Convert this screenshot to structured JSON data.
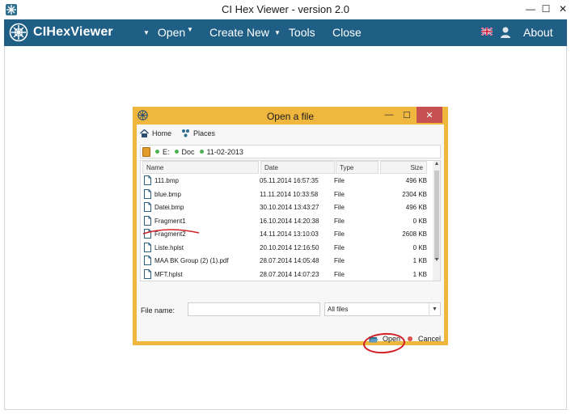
{
  "window": {
    "title": "CI Hex Viewer - version 2.0",
    "controls": {
      "minimize": "—",
      "maximize": "☐",
      "close": "✕"
    }
  },
  "navbar": {
    "brand": "CIHexViewer",
    "menu": [
      {
        "label": "Open",
        "has_caret": true
      },
      {
        "label": "Create New",
        "has_caret": true
      },
      {
        "label": "Tools",
        "has_caret": true
      },
      {
        "label": "Close",
        "has_caret": false
      }
    ],
    "about": "About",
    "language_icon": "uk-flag-icon",
    "user_icon": "user-icon"
  },
  "dialog": {
    "title": "Open a file",
    "toolbar": {
      "home": "Home",
      "places": "Places"
    },
    "path": [
      "E:",
      "Doc",
      "11-02-2013"
    ],
    "columns": {
      "name": "Name",
      "date": "Date",
      "type": "Type",
      "size": "Size"
    },
    "files": [
      {
        "name": "111.bmp",
        "date": "05.11.2014 16:57:35",
        "type": "File",
        "size": "496 KB"
      },
      {
        "name": "blue.bmp",
        "date": "11.11.2014 10:33:58",
        "type": "File",
        "size": "2304 KB"
      },
      {
        "name": "Datei.bmp",
        "date": "30.10.2014 13:43:27",
        "type": "File",
        "size": "496 KB"
      },
      {
        "name": "Fragment1",
        "date": "16.10.2014 14:20:38",
        "type": "File",
        "size": "0 KB"
      },
      {
        "name": "Fragment2",
        "date": "14.11.2014 13:10:03",
        "type": "File",
        "size": "2608 KB"
      },
      {
        "name": "Liste.hplst",
        "date": "20.10.2014 12:16:50",
        "type": "File",
        "size": "0 KB"
      },
      {
        "name": "MAA BK Group (2) (1).pdf",
        "date": "28.07.2014 14:05:48",
        "type": "File",
        "size": "1 KB"
      },
      {
        "name": "MFT.hplst",
        "date": "28.07.2014 14:07:23",
        "type": "File",
        "size": "1 KB"
      }
    ],
    "file_name_label": "File name:",
    "file_name_value": "",
    "filter": "All files",
    "open_button": "Open",
    "cancel_button": "Cancel",
    "colors": {
      "frame": "#f0b73f",
      "annotation": "#d21f25"
    }
  },
  "colors": {
    "navbar": "#1f5f86"
  }
}
